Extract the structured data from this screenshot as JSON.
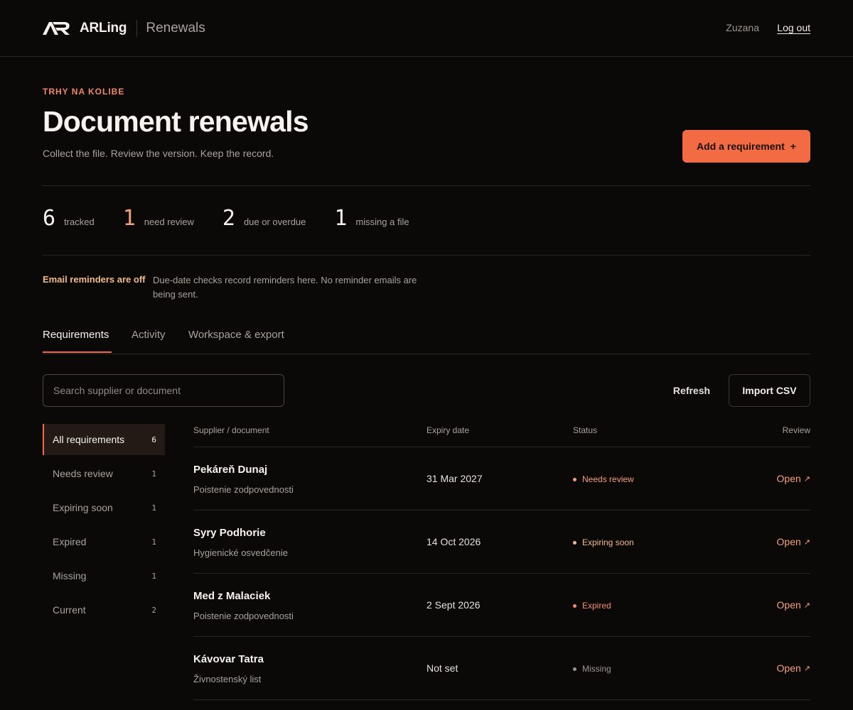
{
  "header": {
    "brand_name": "ARLing",
    "product": "Renewals",
    "user": "Zuzana",
    "logout_label": "Log out"
  },
  "page": {
    "eyebrow": "TRHY NA KOLIBE",
    "title": "Document renewals",
    "subtitle": "Collect the file. Review the version. Keep the record.",
    "add_button": "Add a requirement",
    "add_icon": "+"
  },
  "stats": [
    {
      "value": "6",
      "label": "tracked"
    },
    {
      "value": "1",
      "label": "need review"
    },
    {
      "value": "2",
      "label": "due or overdue"
    },
    {
      "value": "1",
      "label": "missing a file"
    }
  ],
  "notice": {
    "label": "Email reminders are off",
    "text": "Due-date checks record reminders here. No reminder emails are being sent."
  },
  "tabs": [
    {
      "label": "Requirements",
      "active": true
    },
    {
      "label": "Activity",
      "active": false
    },
    {
      "label": "Workspace & export",
      "active": false
    }
  ],
  "toolbar": {
    "search_placeholder": "Search supplier or document",
    "refresh_label": "Refresh",
    "import_label": "Import CSV"
  },
  "filters": [
    {
      "label": "All requirements",
      "count": "6",
      "active": true
    },
    {
      "label": "Needs review",
      "count": "1",
      "active": false
    },
    {
      "label": "Expiring soon",
      "count": "1",
      "active": false
    },
    {
      "label": "Expired",
      "count": "1",
      "active": false
    },
    {
      "label": "Missing",
      "count": "1",
      "active": false
    },
    {
      "label": "Current",
      "count": "2",
      "active": false
    }
  ],
  "table": {
    "columns": [
      "Supplier / document",
      "Expiry date",
      "Status",
      "Review"
    ],
    "rows": [
      {
        "supplier": "Pekáreň Dunaj",
        "document": "Poistenie zodpovednosti",
        "expiry": "31 Mar 2027",
        "status": "Needs review",
        "status_color": "#f3a07f",
        "action": "Open"
      },
      {
        "supplier": "Syry Podhorie",
        "document": "Hygienické osvedčenie",
        "expiry": "14 Oct 2026",
        "status": "Expiring soon",
        "status_color": "#f2b98b",
        "action": "Open"
      },
      {
        "supplier": "Med z Malaciek",
        "document": "Poistenie zodpovednosti",
        "expiry": "2 Sept 2026",
        "status": "Expired",
        "status_color": "#f38c6b",
        "action": "Open"
      },
      {
        "supplier": "Kávovar Tatra",
        "document": "Živnostenský list",
        "expiry": "Not set",
        "status": "Missing",
        "status_color": "#9d9690",
        "action": "Open"
      }
    ]
  },
  "icons": {
    "logo": "ar-logo-icon",
    "open_arrow": "arrow-up-right-icon"
  },
  "colors": {
    "accent": "#f26b43",
    "accent_soft": "#f3a07f",
    "background": "#0b0908"
  }
}
